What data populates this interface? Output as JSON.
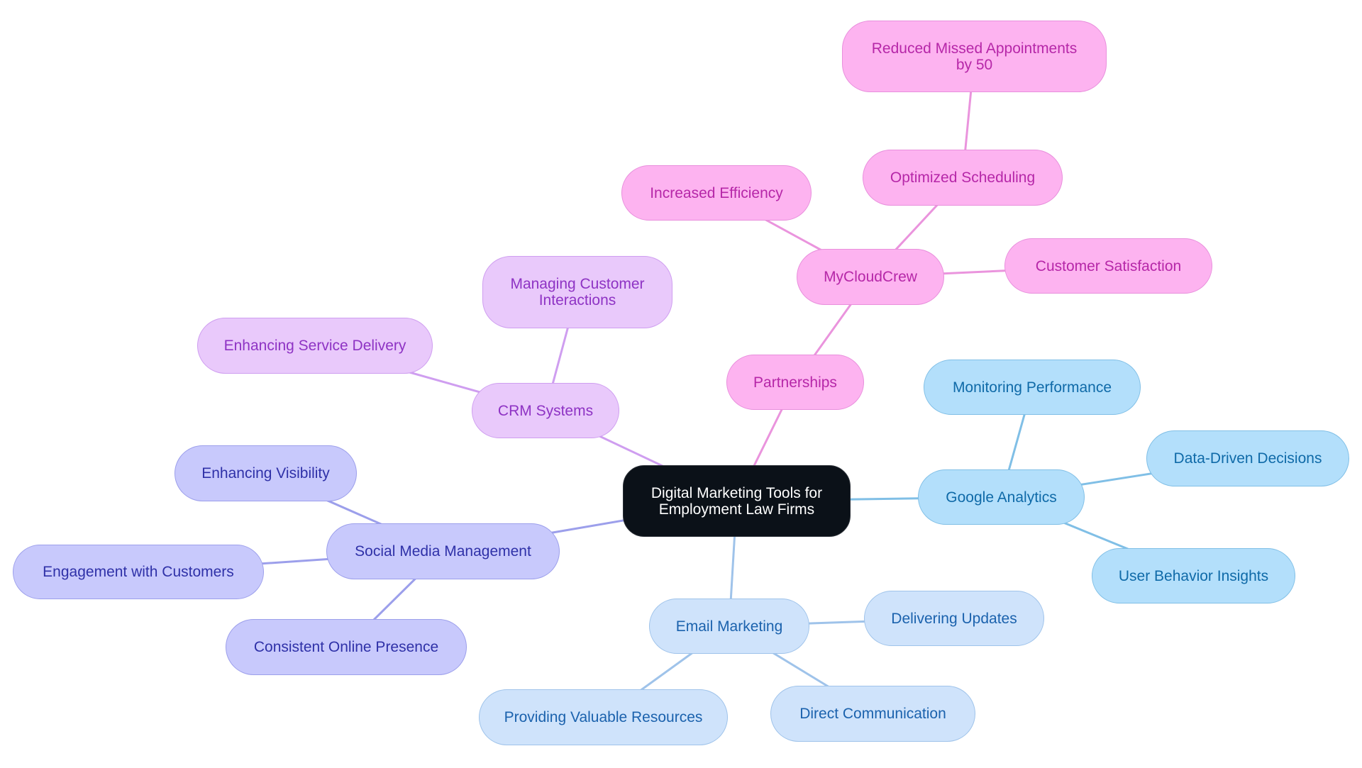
{
  "title": "Digital Marketing Tools for Employment Law Firms mind map",
  "palette": {
    "root": {
      "fill": "#0b1118",
      "stroke": "#2a2f36",
      "text": "#ffffff"
    },
    "pink": {
      "fill": "#fdb3f0",
      "stroke": "#e88fdc",
      "text": "#b627a8",
      "edge": "#ea94dd"
    },
    "purple": {
      "fill": "#e9c9fb",
      "stroke": "#cf9ef0",
      "text": "#8e33c4",
      "edge": "#cf9ef0"
    },
    "indigo": {
      "fill": "#c8c9fc",
      "stroke": "#9c9feb",
      "text": "#2f31a8",
      "edge": "#9c9feb"
    },
    "lightblue": {
      "fill": "#cfe3fb",
      "stroke": "#9fc3ea",
      "text": "#1b62ad",
      "edge": "#9fc3ea"
    },
    "skyblue": {
      "fill": "#b3dffb",
      "stroke": "#80bfe6",
      "text": "#0f6aa8",
      "edge": "#80bfe6"
    }
  },
  "nodes": [
    {
      "id": "root",
      "label": "Digital Marketing Tools for\nEmployment Law Firms",
      "theme": "root"
    },
    {
      "id": "partnerships",
      "label": "Partnerships",
      "theme": "pink",
      "parent": "root"
    },
    {
      "id": "mycloudcrew",
      "label": "MyCloudCrew",
      "theme": "pink",
      "parent": "partnerships"
    },
    {
      "id": "optimized-scheduling",
      "label": "Optimized Scheduling",
      "theme": "pink",
      "parent": "mycloudcrew"
    },
    {
      "id": "reduced-missed",
      "label": "Reduced Missed Appointments\nby 50",
      "theme": "pink",
      "parent": "optimized-scheduling"
    },
    {
      "id": "increased-efficiency",
      "label": "Increased Efficiency",
      "theme": "pink",
      "parent": "mycloudcrew"
    },
    {
      "id": "customer-satisfaction",
      "label": "Customer Satisfaction",
      "theme": "pink",
      "parent": "mycloudcrew"
    },
    {
      "id": "crm-systems",
      "label": "CRM Systems",
      "theme": "purple",
      "parent": "root"
    },
    {
      "id": "managing-interactions",
      "label": "Managing Customer\nInteractions",
      "theme": "purple",
      "parent": "crm-systems"
    },
    {
      "id": "enhancing-service",
      "label": "Enhancing Service Delivery",
      "theme": "purple",
      "parent": "crm-systems"
    },
    {
      "id": "social-media",
      "label": "Social Media Management",
      "theme": "indigo",
      "parent": "root"
    },
    {
      "id": "enhancing-visibility",
      "label": "Enhancing Visibility",
      "theme": "indigo",
      "parent": "social-media"
    },
    {
      "id": "engagement",
      "label": "Engagement with Customers",
      "theme": "indigo",
      "parent": "social-media"
    },
    {
      "id": "consistent-presence",
      "label": "Consistent Online Presence",
      "theme": "indigo",
      "parent": "social-media"
    },
    {
      "id": "email-marketing",
      "label": "Email Marketing",
      "theme": "lightblue",
      "parent": "root"
    },
    {
      "id": "delivering-updates",
      "label": "Delivering Updates",
      "theme": "lightblue",
      "parent": "email-marketing"
    },
    {
      "id": "direct-communication",
      "label": "Direct Communication",
      "theme": "lightblue",
      "parent": "email-marketing"
    },
    {
      "id": "valuable-resources",
      "label": "Providing Valuable Resources",
      "theme": "lightblue",
      "parent": "email-marketing"
    },
    {
      "id": "google-analytics",
      "label": "Google Analytics",
      "theme": "skyblue",
      "parent": "root"
    },
    {
      "id": "monitoring-performance",
      "label": "Monitoring Performance",
      "theme": "skyblue",
      "parent": "google-analytics"
    },
    {
      "id": "data-driven",
      "label": "Data-Driven Decisions",
      "theme": "skyblue",
      "parent": "google-analytics"
    },
    {
      "id": "user-behavior",
      "label": "User Behavior Insights",
      "theme": "skyblue",
      "parent": "google-analytics"
    }
  ]
}
